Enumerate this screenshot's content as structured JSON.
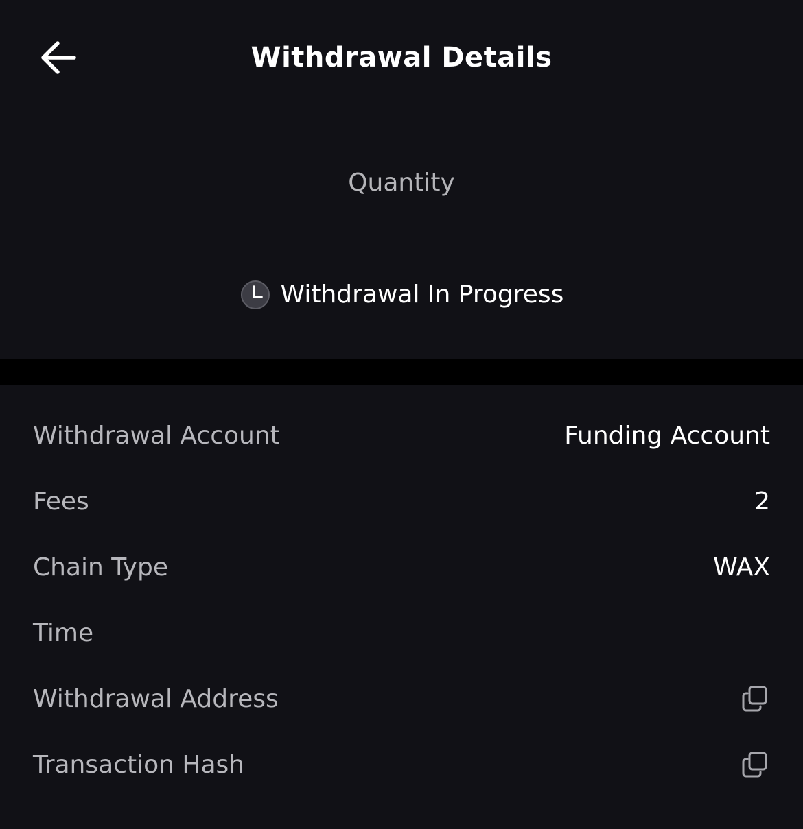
{
  "header": {
    "back_icon": "arrow-left-icon",
    "title": "Withdrawal Details"
  },
  "summary": {
    "quantity_label": "Quantity",
    "status_icon": "clock-icon",
    "status_text": "Withdrawal In Progress"
  },
  "details": {
    "rows": [
      {
        "label": "Withdrawal Account",
        "value": "Funding Account"
      },
      {
        "label": "Fees",
        "value": "2"
      },
      {
        "label": "Chain Type",
        "value": "WAX"
      },
      {
        "label": "Time",
        "value": ""
      },
      {
        "label": "Withdrawal Address",
        "action_icon": "copy-icon"
      },
      {
        "label": "Transaction Hash",
        "action_icon": "copy-icon"
      }
    ]
  },
  "colors": {
    "background": "#111116",
    "divider": "#000000",
    "label_text": "#b7b7bc",
    "value_text": "#ffffff"
  }
}
